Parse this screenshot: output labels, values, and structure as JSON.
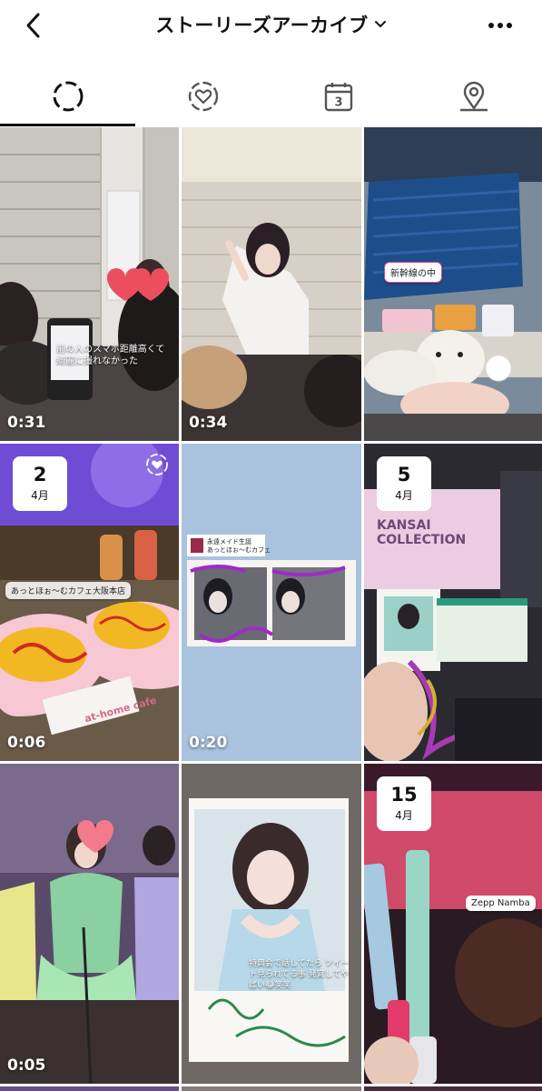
{
  "header": {
    "title": "ストーリーズアーカイブ",
    "back_icon": "back-arrow-icon",
    "dropdown_icon": "chevron-down-icon",
    "more_icon": "more-horizontal-icon"
  },
  "tabs": [
    {
      "name": "stories",
      "icon": "stories-ring-icon",
      "active": true
    },
    {
      "name": "highlights",
      "icon": "heart-ring-icon",
      "active": false
    },
    {
      "name": "calendar",
      "icon": "calendar-icon",
      "calendar_day": "3",
      "active": false
    },
    {
      "name": "map",
      "icon": "location-pin-icon",
      "active": false
    }
  ],
  "stories": [
    {
      "duration": "0:31",
      "overlay_text": "前の人のスマホ距離高くて 綺麗に撮れなかった"
    },
    {
      "duration": "0:34"
    },
    {
      "location_sticker": "新幹線の中"
    },
    {
      "date_day": "2",
      "date_month": "4月",
      "location_sticker": "あっとほぉ〜むカフェ大阪本店",
      "logo_text": "at-home cafe",
      "duration": "0:06"
    },
    {
      "label_title": "永遠メイド生誕",
      "label_sub": "あっとほぉ〜むカフェ",
      "duration": "0:20"
    },
    {
      "date_day": "5",
      "date_month": "4月",
      "big_text": "KANSAI COLLECTION"
    },
    {
      "duration": "0:05"
    },
    {
      "overlay_text": "特典会で話してたら ツイート見られてる事 発覚してやばい😂笑笑"
    },
    {
      "date_day": "15",
      "date_month": "4月",
      "location_sticker": "Zepp Namba"
    }
  ],
  "colors": {
    "accent": "#111111",
    "sticker_pink": "#e8458b",
    "overlay_white": "#ffffff"
  }
}
